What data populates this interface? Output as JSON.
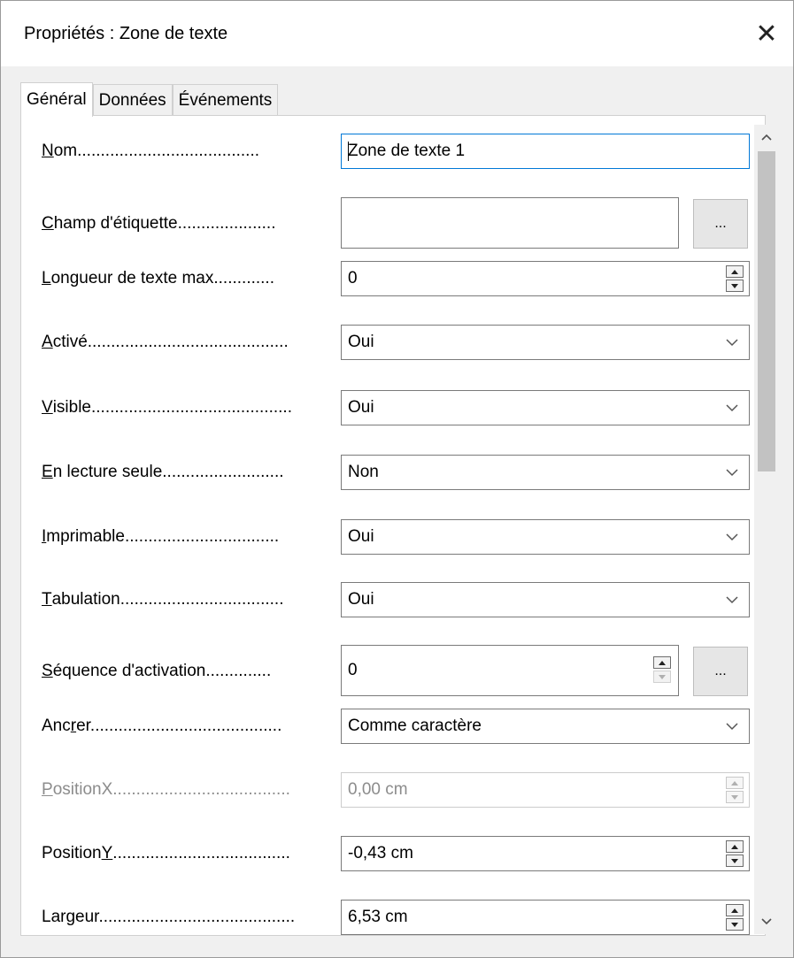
{
  "window": {
    "title": "Propriétés : Zone de texte",
    "close_glyph": "✕"
  },
  "tabs": [
    {
      "label": "Général",
      "active": true
    },
    {
      "label": "Données",
      "active": false
    },
    {
      "label": "Événements",
      "active": false
    }
  ],
  "form": {
    "nom": {
      "label_u": "N",
      "label_rest": "om.......................................",
      "value": "Zone de texte 1"
    },
    "champ_etiquette": {
      "label_u": "C",
      "label_rest": "hamp d'étiquette.....................",
      "value": "",
      "button": "..."
    },
    "longueur": {
      "label_u": "L",
      "label_rest": "ongueur de texte max.............",
      "value": "0"
    },
    "active": {
      "label_u": "A",
      "label_rest": "ctivé...........................................",
      "value": "Oui"
    },
    "visible": {
      "label_u": "V",
      "label_rest": "isible...........................................",
      "value": "Oui"
    },
    "lecture_seule": {
      "label_u": "E",
      "label_rest": "n lecture seule..........................",
      "value": "Non"
    },
    "imprimable": {
      "label_u": "I",
      "label_rest": "mprimable.................................",
      "value": "Oui"
    },
    "tabulation": {
      "label_u": "T",
      "label_rest": "abulation...................................",
      "value": "Oui"
    },
    "sequence": {
      "label_u": "S",
      "label_rest": "équence d'activation..............",
      "value": "0",
      "button": "..."
    },
    "ancrer": {
      "label_pre": "Anc",
      "label_u": "r",
      "label_rest": "er.........................................",
      "value": "Comme caractère"
    },
    "position_x": {
      "label_u": "P",
      "label_rest": "ositionX......................................",
      "value": "0,00 cm"
    },
    "position_y": {
      "label_pre": "Position",
      "label_u": "Y",
      "label_rest": "......................................",
      "value": "-0,43 cm"
    },
    "largeur": {
      "label_u": "",
      "label_rest": "Largeur..........................................",
      "value": "6,53 cm"
    }
  },
  "scrollbar": {
    "up_glyph": "⌃",
    "down_glyph": "⌄"
  }
}
